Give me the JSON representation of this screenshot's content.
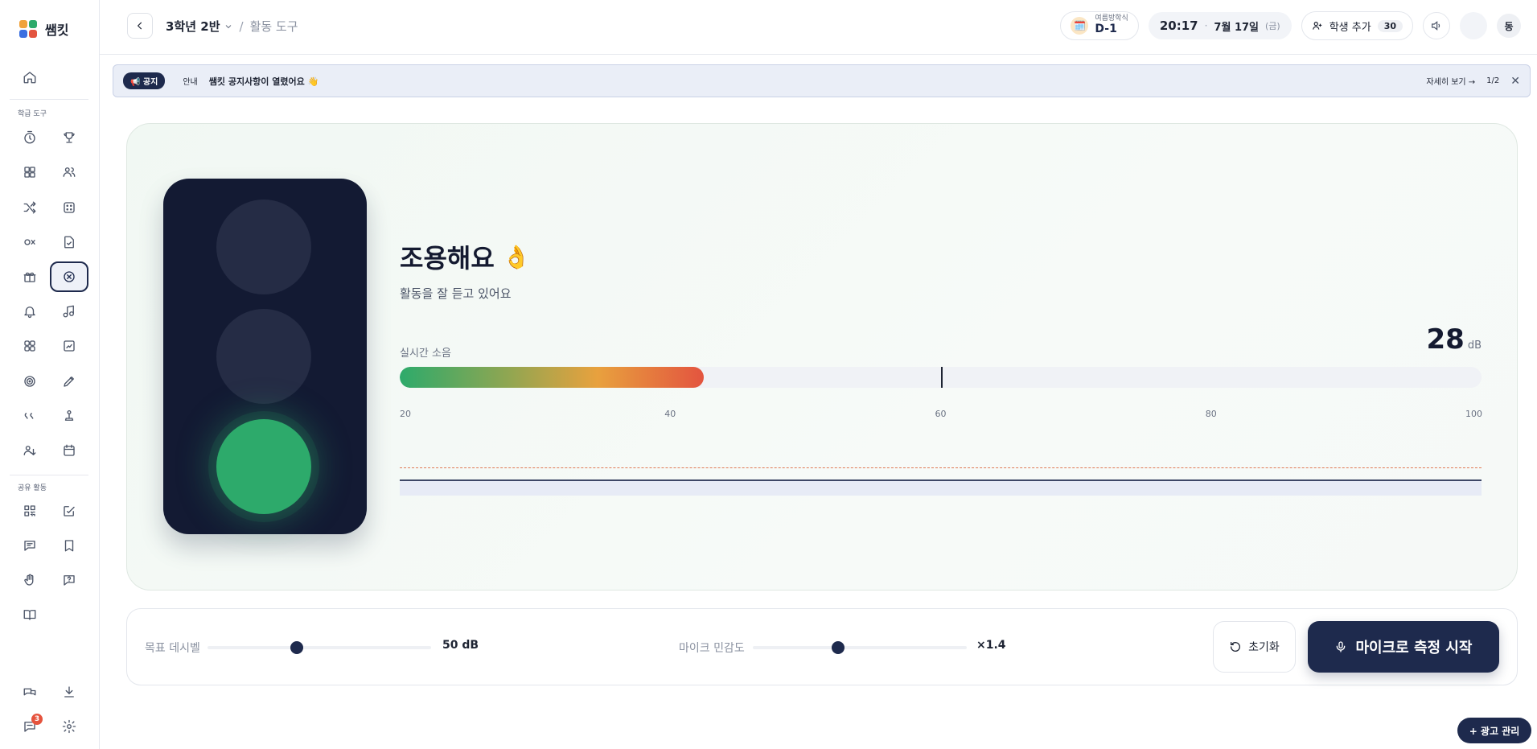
{
  "app": {
    "name": "쌤킷"
  },
  "sidebar": {
    "section_tools": "학급 도구",
    "section_shared": "공유 활동",
    "chat_badge": "3"
  },
  "header": {
    "class_name": "3학년 2반",
    "tool_name": "활동 도구",
    "dday_label": "여름방학식",
    "dday_value": "D-1",
    "time": "20:17",
    "date": "7월 17일",
    "weekday": "(금)",
    "add_student_label": "학생 추가",
    "student_count": "30",
    "avatar_initial": "동"
  },
  "notice": {
    "tag": "📢 공지",
    "kind": "안내",
    "message": "쌤킷 공지사항이 열렸어요 👋",
    "more_label": "자세히 보기 →",
    "page": "1/2",
    "close": "✕"
  },
  "meter": {
    "status_title": "조용해요",
    "status_emoji": "👌",
    "status_sub": "활동을 잘 듣고 있어요",
    "label": "실시간 소음",
    "db_value": "28",
    "db_unit": "dB",
    "scale_min": 20,
    "scale_max": 100,
    "current_db": 42.5,
    "target_db": 60,
    "ticks": [
      "20",
      "40",
      "60",
      "80",
      "100"
    ],
    "active_light": "green"
  },
  "controls": {
    "target_label": "목표 데시벨",
    "target_value": "50 dB",
    "target_fraction": 0.4,
    "mic_label": "마이크 민감도",
    "mic_value": "×1.4",
    "mic_fraction": 0.4,
    "reset_label": "초기화",
    "start_label": "마이크로 측정 시작"
  },
  "ad_button": "+ 광고 관리",
  "colors": {
    "primary": "#1e2a4d",
    "green": "#2daa6b",
    "red": "#e3543f",
    "amber": "#e8a13e"
  }
}
